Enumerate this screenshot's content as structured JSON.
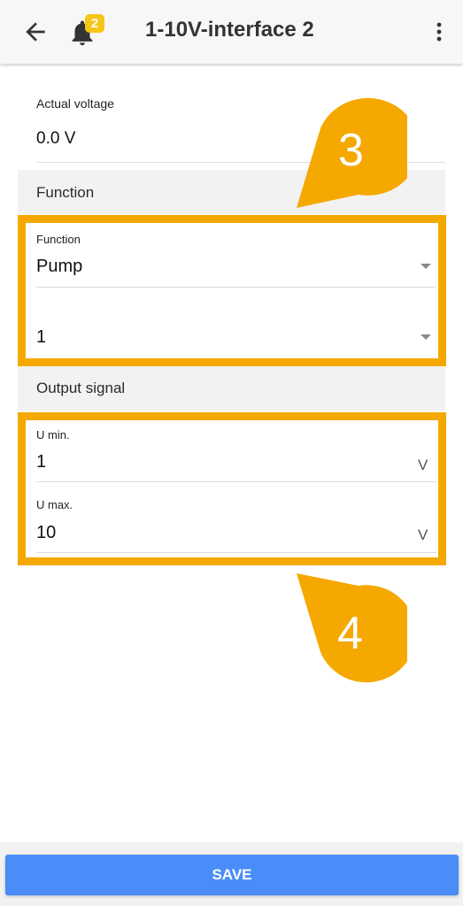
{
  "header": {
    "title": "1-10V-interface 2",
    "badge_count": "2",
    "icons": [
      "arrow-left-icon",
      "bell-icon",
      "more-vertical-icon"
    ]
  },
  "actual_voltage": {
    "label": "Actual voltage",
    "value": "0.0 V"
  },
  "function_section": {
    "heading": "Function",
    "function_label": "Function",
    "function_value": "Pump",
    "second_value": "1"
  },
  "output_section": {
    "heading": "Output signal",
    "umin_label": "U min.",
    "umin_value": "1",
    "umin_unit": "V",
    "umax_label": "U max.",
    "umax_value": "10",
    "umax_unit": "V"
  },
  "callouts": {
    "first": "3",
    "second": "4"
  },
  "footer": {
    "save_label": "SAVE"
  },
  "colors": {
    "accent": "#f5a800",
    "button": "#4a8df8",
    "badge": "#f5c518"
  }
}
